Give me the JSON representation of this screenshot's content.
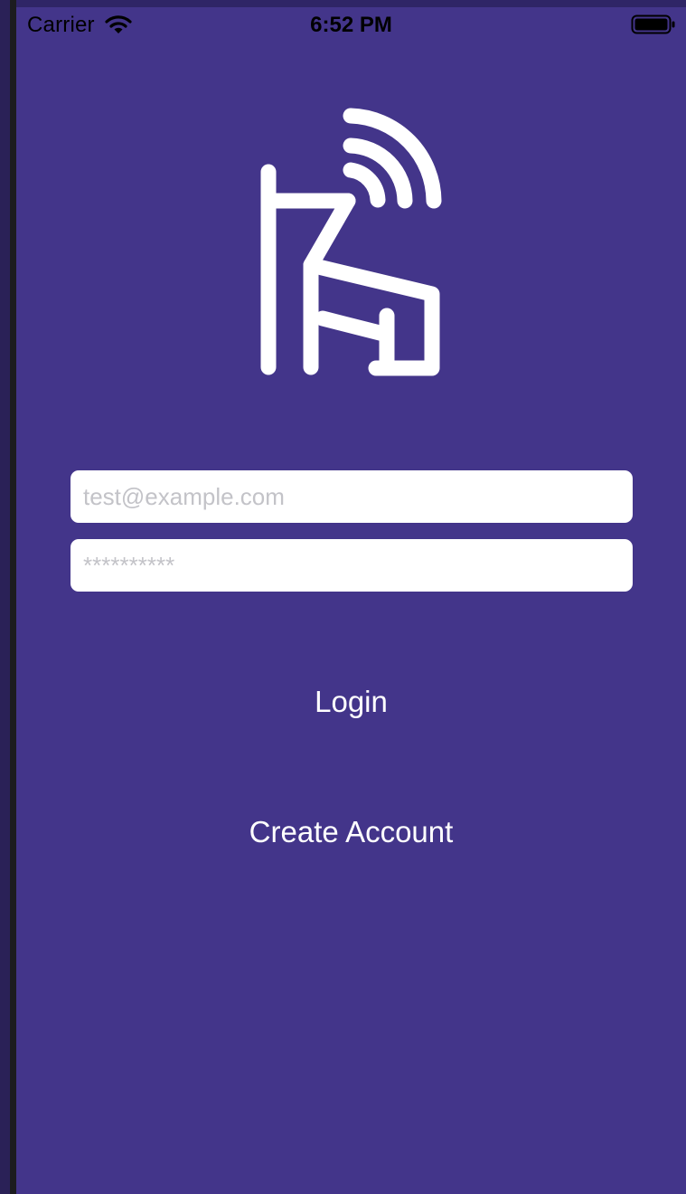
{
  "status_bar": {
    "carrier": "Carrier",
    "time": "6:52 PM",
    "icons": [
      "wifi-icon",
      "battery-icon"
    ]
  },
  "logo": {
    "icon": "antenna-router-logo",
    "color": "#ffffff"
  },
  "form": {
    "email_placeholder": "test@example.com",
    "email_value": "",
    "password_placeholder": "**********",
    "password_value": ""
  },
  "actions": {
    "login_label": "Login",
    "create_account_label": "Create Account"
  },
  "colors": {
    "background": "#43358a",
    "field_background": "#ffffff",
    "placeholder": "#c3c3c8",
    "button_text": "#ffffff"
  }
}
